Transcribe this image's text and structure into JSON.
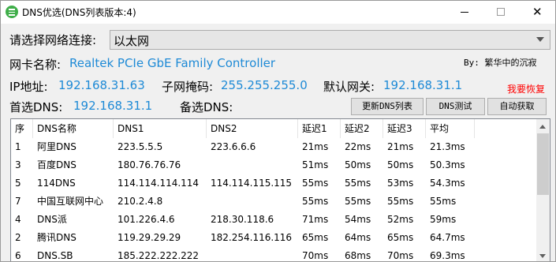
{
  "window": {
    "title": "DNS优选(DNS列表版本:4)",
    "icon": "green-menu-icon",
    "controls": {
      "minimize": "minimize-icon",
      "maximize": "maximize-icon",
      "close": "✕"
    }
  },
  "connection": {
    "label": "请选择网络连接:",
    "selected": "以太网"
  },
  "author": "By: 繁华中的沉寂",
  "nic": {
    "label": "网卡名称:",
    "value": "Realtek PCIe GbE Family Controller"
  },
  "ip": {
    "ip_label": "IP地址:",
    "ip_value": "192.168.31.63",
    "mask_label": "子网掩码:",
    "mask_value": "255.255.255.0",
    "gateway_label": "默认网关:",
    "gateway_value": "192.168.31.1"
  },
  "restore_link": "我要恢复",
  "dns": {
    "primary_label": "首选DNS:",
    "primary_value": "192.168.31.1",
    "secondary_label": "备选DNS:",
    "secondary_value": ""
  },
  "buttons": {
    "update": "更新DNS列表",
    "test": "DNS测试",
    "auto": "自动获取"
  },
  "table": {
    "headers": [
      "序",
      "DNS名称",
      "DNS1",
      "DNS2",
      "延迟1",
      "延迟2",
      "延迟3",
      "平均"
    ],
    "rows": [
      [
        "1",
        "阿里DNS",
        "223.5.5.5",
        "223.6.6.6",
        "21ms",
        "22ms",
        "21ms",
        "21.3ms"
      ],
      [
        "3",
        "百度DNS",
        "180.76.76.76",
        "",
        "51ms",
        "50ms",
        "50ms",
        "50.3ms"
      ],
      [
        "5",
        "114DNS",
        "114.114.114.114",
        "114.114.115.115",
        "55ms",
        "55ms",
        "53ms",
        "54.3ms"
      ],
      [
        "7",
        "中国互联网中心",
        "210.2.4.8",
        "",
        "55ms",
        "55ms",
        "55ms",
        "55ms"
      ],
      [
        "4",
        "DNS派",
        "101.226.4.6",
        "218.30.118.6",
        "71ms",
        "54ms",
        "52ms",
        "59ms"
      ],
      [
        "2",
        "腾讯DNS",
        "119.29.29.29",
        "182.254.116.116",
        "65ms",
        "64ms",
        "65ms",
        "64.7ms"
      ],
      [
        "6",
        "DNS.SB",
        "185.222.222.222",
        "",
        "70ms",
        "68ms",
        "70ms",
        "69.3ms"
      ]
    ]
  },
  "colors": {
    "value_blue": "#1e8ad6",
    "restore_red": "#ff0000",
    "window_bg": "#f0f0f0"
  }
}
